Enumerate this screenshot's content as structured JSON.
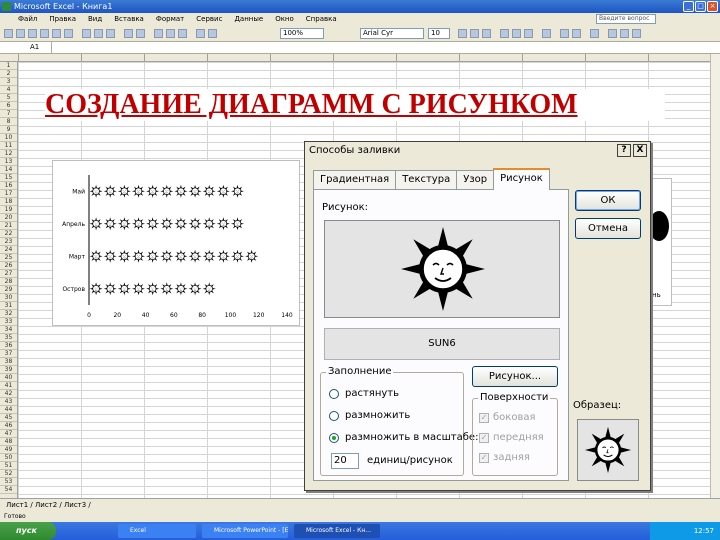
{
  "window": {
    "title": "Microsoft Excel - Книга1",
    "help_placeholder": "Введите вопрос"
  },
  "menu": [
    "Файл",
    "Правка",
    "Вид",
    "Вставка",
    "Формат",
    "Сервис",
    "Данные",
    "Окно",
    "Справка"
  ],
  "toolbar": {
    "font_name": "Arial Cyr",
    "font_size": "10",
    "zoom": "100%"
  },
  "namebox": "A1",
  "rows": [
    "1",
    "2",
    "3",
    "4",
    "5",
    "6",
    "7",
    "8",
    "9",
    "10",
    "11",
    "12",
    "13",
    "14",
    "15",
    "16",
    "17",
    "18",
    "19",
    "20",
    "21",
    "22",
    "23",
    "24",
    "25",
    "26",
    "27",
    "28",
    "29",
    "30",
    "31",
    "32",
    "33",
    "34",
    "35",
    "36",
    "37",
    "38",
    "39",
    "40",
    "41",
    "42",
    "43",
    "44",
    "45",
    "46",
    "47",
    "48",
    "49",
    "50",
    "51",
    "52",
    "53",
    "54"
  ],
  "slide_title": "СОЗДАНИЕ ДИАГРАММ С РИСУНКОМ",
  "chart_data": {
    "type": "bar",
    "orientation": "horizontal",
    "categories": [
      "Май",
      "Апрель",
      "Март",
      "Остров"
    ],
    "values": [
      100,
      108,
      110,
      85
    ],
    "xlim": [
      0,
      140
    ],
    "xticks": [
      0,
      20,
      40,
      60,
      80,
      100,
      120,
      140
    ],
    "units_per_picture": 10,
    "grid": false,
    "legend": "none",
    "fill": "picture (sun icon, stacked)"
  },
  "chart_fragment": "нь",
  "dialog": {
    "title": "Способы заливки",
    "help_btn": "?",
    "close_btn": "X",
    "tabs": [
      "Градиентная",
      "Текстура",
      "Узор",
      "Рисунок"
    ],
    "active_tab": "Рисунок",
    "picture_label": "Рисунок:",
    "picture_name": "SUN6",
    "fill_group": "Заполнение",
    "fill_options": [
      "растянуть",
      "размножить",
      "размножить в масштабе:"
    ],
    "fill_selected": 2,
    "scale_value": "20",
    "scale_units": "единиц/рисунок",
    "picture_button": "Рисунок...",
    "surfaces_group": "Поверхности",
    "surfaces": [
      "боковая",
      "передняя",
      "задняя"
    ],
    "ok": "ОК",
    "cancel": "Отмена",
    "sample_label": "Образец:"
  },
  "sheet_tabs": "Лист1 / Лист2 / Лист3 /",
  "status": "Готово",
  "taskbar": {
    "start": "пуск",
    "items": [
      "Excel",
      "Microsoft PowerPoint - [Ex...",
      "Microsoft Excel - Кн..."
    ],
    "clock": "12:57"
  },
  "colors": {
    "title_red": "#c00000",
    "xp_blue": "#245edb",
    "tab_accent": "#e68b2c"
  }
}
